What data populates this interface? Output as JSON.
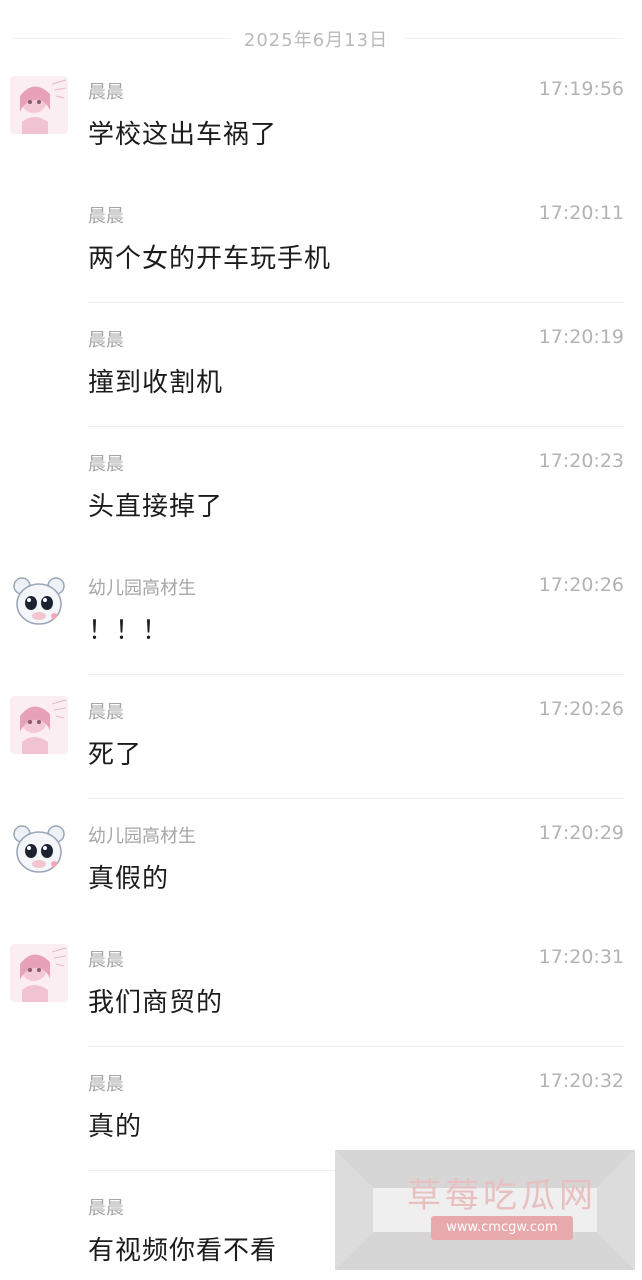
{
  "date_separator": "2025年6月13日",
  "messages": [
    {
      "sender": "晨晨",
      "time": "17:19:56",
      "text": "学校这出车祸了",
      "avatar": "girl-avatar"
    },
    {
      "sender": "晨晨",
      "time": "17:20:11",
      "text": "两个女的开车玩手机",
      "avatar": ""
    },
    {
      "sender": "晨晨",
      "time": "17:20:19",
      "text": "撞到收割机",
      "avatar": ""
    },
    {
      "sender": "晨晨",
      "time": "17:20:23",
      "text": "头直接掉了",
      "avatar": ""
    },
    {
      "sender": "幼儿园高材生",
      "time": "17:20:26",
      "text": "！！！",
      "avatar": "bear-avatar"
    },
    {
      "sender": "晨晨",
      "time": "17:20:26",
      "text": "死了",
      "avatar": "girl-avatar"
    },
    {
      "sender": "幼儿园高材生",
      "time": "17:20:29",
      "text": "真假的",
      "avatar": "bear-avatar"
    },
    {
      "sender": "晨晨",
      "time": "17:20:31",
      "text": "我们商贸的",
      "avatar": "girl-avatar"
    },
    {
      "sender": "晨晨",
      "time": "17:20:32",
      "text": "真的",
      "avatar": ""
    },
    {
      "sender": "晨晨",
      "time": "",
      "text": "有视频你看不看",
      "avatar": ""
    }
  ],
  "watermark": {
    "title": "草莓吃瓜网",
    "url": "www.cmcgw.com"
  },
  "colors": {
    "background": "#ffffff",
    "text": "#1c1c1c",
    "meta": "#a6a6a6",
    "watermark_bg": "#d9d9d9",
    "watermark_text": "#e8c0c0"
  }
}
